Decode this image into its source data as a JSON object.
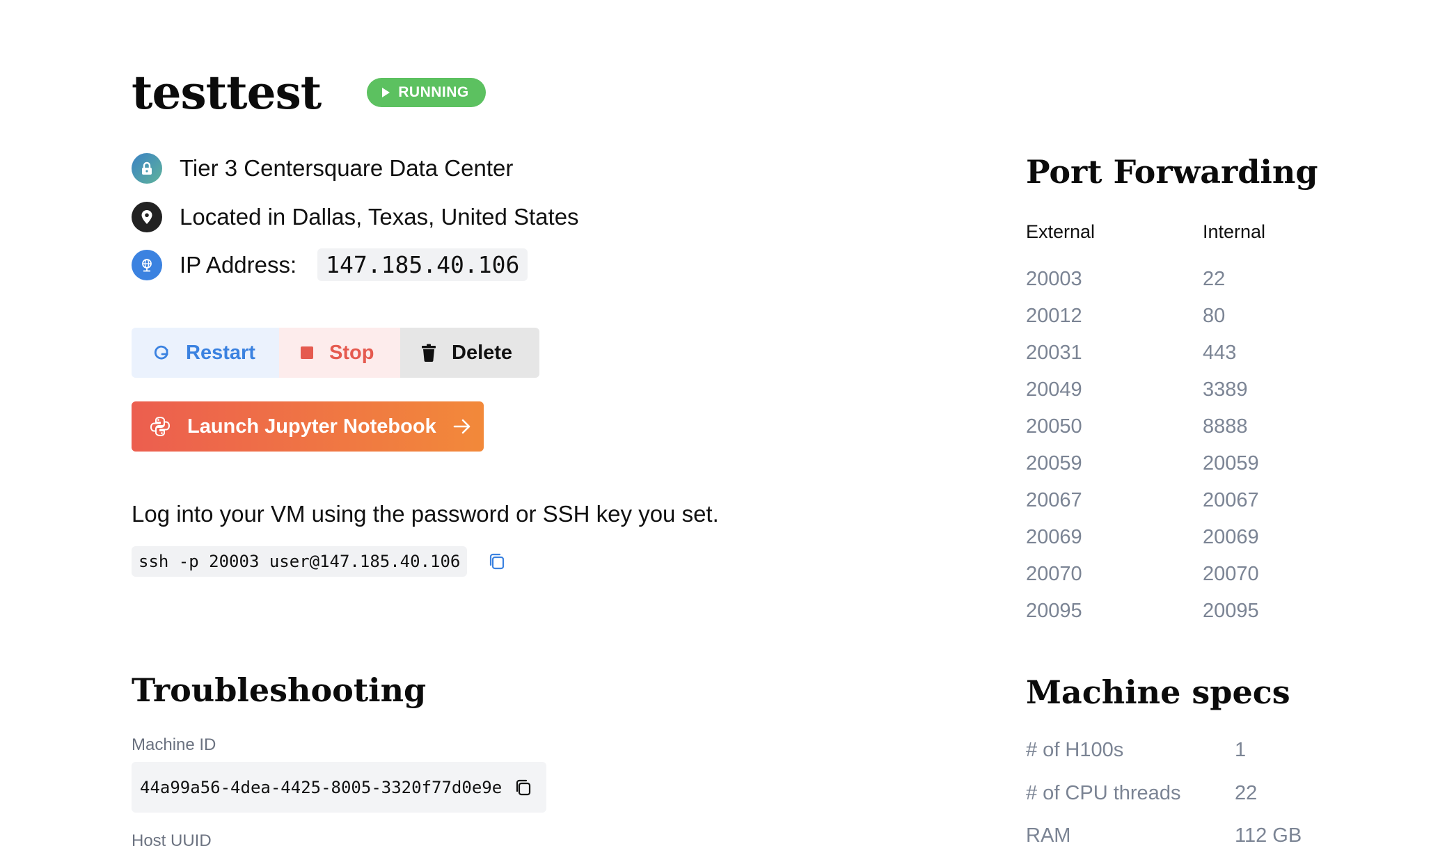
{
  "vm": {
    "name": "testtest",
    "status": "RUNNING",
    "datacenter": "Tier 3 Centersquare Data Center",
    "location": "Located in Dallas, Texas, United States",
    "ip_label": "IP Address:",
    "ip": "147.185.40.106"
  },
  "actions": {
    "restart": "Restart",
    "stop": "Stop",
    "delete": "Delete",
    "jupyter": "Launch Jupyter Notebook"
  },
  "login": {
    "text": "Log into your VM using the password or SSH key you set.",
    "ssh_command": "ssh -p 20003 user@147.185.40.106"
  },
  "troubleshooting": {
    "heading": "Troubleshooting",
    "machine_id_label": "Machine ID",
    "machine_id": "44a99a56-4dea-4425-8005-3320f77d0e9e",
    "host_uuid_label": "Host UUID"
  },
  "port_forwarding": {
    "heading": "Port Forwarding",
    "col_external": "External",
    "col_internal": "Internal",
    "rows": [
      {
        "external": "20003",
        "internal": "22"
      },
      {
        "external": "20012",
        "internal": "80"
      },
      {
        "external": "20031",
        "internal": "443"
      },
      {
        "external": "20049",
        "internal": "3389"
      },
      {
        "external": "20050",
        "internal": "8888"
      },
      {
        "external": "20059",
        "internal": "20059"
      },
      {
        "external": "20067",
        "internal": "20067"
      },
      {
        "external": "20069",
        "internal": "20069"
      },
      {
        "external": "20070",
        "internal": "20070"
      },
      {
        "external": "20095",
        "internal": "20095"
      }
    ]
  },
  "machine_specs": {
    "heading": "Machine specs",
    "rows": [
      {
        "label": "# of H100s",
        "value": "1"
      },
      {
        "label": "# of CPU threads",
        "value": "22"
      },
      {
        "label": "RAM",
        "value": "112 GB"
      }
    ]
  },
  "colors": {
    "running": "#5cc160",
    "restart": "#3b82e0",
    "stop": "#e55a4f",
    "jupyter_start": "#ec5e4f",
    "jupyter_end": "#f2893a"
  },
  "icons": [
    "lock-icon",
    "location-pin-icon",
    "globe-icon",
    "restart-icon",
    "stop-icon",
    "trash-icon",
    "python-icon",
    "arrow-right-icon",
    "copy-icon"
  ]
}
